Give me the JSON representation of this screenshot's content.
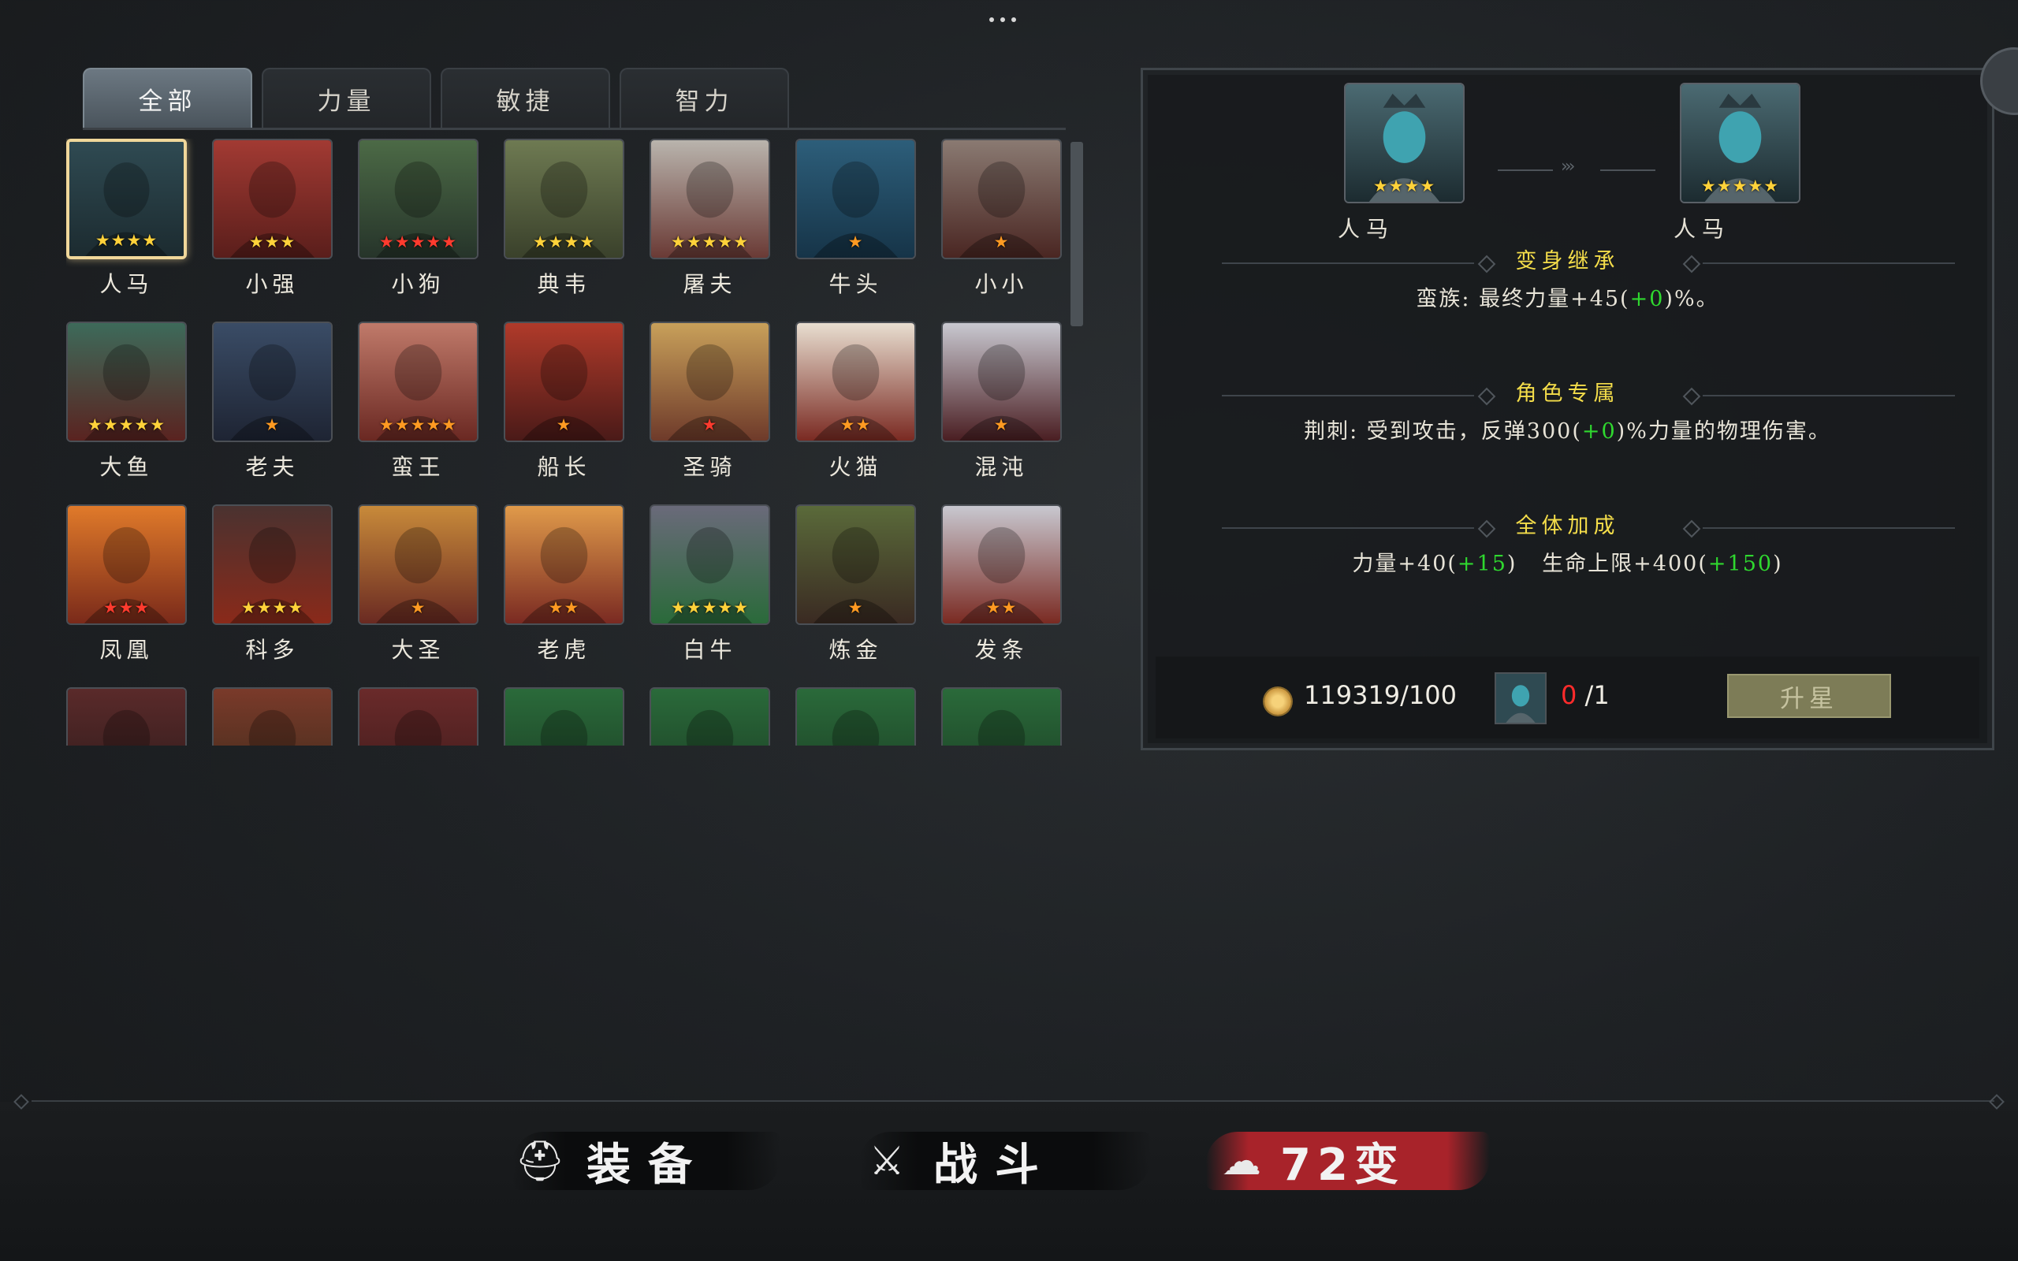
{
  "tabs": [
    "全部",
    "力量",
    "敏捷",
    "智力"
  ],
  "heroes": [
    {
      "name": "人马",
      "stars": "★★★★",
      "star_color": "gold",
      "colors": [
        "#2f4a52",
        "#1c2b30"
      ],
      "selected": true
    },
    {
      "name": "小强",
      "stars": "★★★",
      "star_color": "gold",
      "colors": [
        "#a23a33",
        "#5a1e1b"
      ]
    },
    {
      "name": "小狗",
      "stars": "★★★★★",
      "star_color": "red",
      "colors": [
        "#4c6a46",
        "#26342a"
      ]
    },
    {
      "name": "典韦",
      "stars": "★★★★",
      "star_color": "gold",
      "colors": [
        "#6e7a52",
        "#3a412b"
      ]
    },
    {
      "name": "屠夫",
      "stars": "★★★★★",
      "star_color": "gold",
      "colors": [
        "#b9b4ad",
        "#6a3a35"
      ]
    },
    {
      "name": "牛头",
      "stars": "★",
      "star_color": "orange",
      "colors": [
        "#2d5e7a",
        "#163448"
      ]
    },
    {
      "name": "小小",
      "stars": "★",
      "star_color": "orange",
      "colors": [
        "#8a7a72",
        "#4a2622"
      ]
    },
    {
      "name": "大鱼",
      "stars": "★★★★★",
      "star_color": "gold",
      "colors": [
        "#3d6a5a",
        "#5a2320"
      ]
    },
    {
      "name": "老夫",
      "stars": "★",
      "star_color": "orange",
      "colors": [
        "#3a4c66",
        "#1e2433"
      ]
    },
    {
      "name": "蛮王",
      "stars": "★★★★★",
      "star_color": "orange",
      "colors": [
        "#c07a6a",
        "#6a2822"
      ]
    },
    {
      "name": "船长",
      "stars": "★",
      "star_color": "orange",
      "colors": [
        "#b03a2a",
        "#4a1a18"
      ]
    },
    {
      "name": "圣骑",
      "stars": "★",
      "star_color": "red",
      "colors": [
        "#c8a05a",
        "#6e3a2a"
      ]
    },
    {
      "name": "火猫",
      "stars": "★★",
      "star_color": "orange",
      "colors": [
        "#e8ded0",
        "#7a2a22"
      ]
    },
    {
      "name": "混沌",
      "stars": "★",
      "star_color": "orange",
      "colors": [
        "#c8c8d0",
        "#4a1e22"
      ]
    },
    {
      "name": "凤凰",
      "stars": "★★★",
      "star_color": "red",
      "colors": [
        "#e07a2a",
        "#7a2a1a"
      ]
    },
    {
      "name": "科多",
      "stars": "★★★★",
      "star_color": "gold",
      "colors": [
        "#4a3230",
        "#8a2a1a"
      ]
    },
    {
      "name": "大圣",
      "stars": "★",
      "star_color": "orange",
      "colors": [
        "#c88a3a",
        "#6a2a22"
      ]
    },
    {
      "name": "老虎",
      "stars": "★★",
      "star_color": "orange",
      "colors": [
        "#e09a4a",
        "#7a2a22"
      ]
    },
    {
      "name": "白牛",
      "stars": "★★★★★",
      "star_color": "gold",
      "colors": [
        "#6a6a7a",
        "#2a6a3a"
      ]
    },
    {
      "name": "炼金",
      "stars": "★",
      "star_color": "orange",
      "colors": [
        "#5a6a3a",
        "#3a2a22"
      ]
    },
    {
      "name": "发条",
      "stars": "★★",
      "star_color": "orange",
      "colors": [
        "#c8c8d0",
        "#7a2a22"
      ]
    },
    {
      "name": "",
      "stars": "",
      "star_color": "gold",
      "colors": [
        "#5a2a2a",
        "#2a1a1a"
      ]
    },
    {
      "name": "",
      "stars": "",
      "star_color": "gold",
      "colors": [
        "#7a3a2a",
        "#3a2a1a"
      ]
    },
    {
      "name": "",
      "stars": "",
      "star_color": "gold",
      "colors": [
        "#6a2a2a",
        "#3a1a1a"
      ]
    },
    {
      "name": "",
      "stars": "",
      "star_color": "gold",
      "colors": [
        "#2a6a3a",
        "#1a3a22"
      ]
    },
    {
      "name": "",
      "stars": "",
      "star_color": "gold",
      "colors": [
        "#2a6a3a",
        "#1a3a22"
      ]
    },
    {
      "name": "",
      "stars": "",
      "star_color": "gold",
      "colors": [
        "#2a6a3a",
        "#1a3a22"
      ]
    },
    {
      "name": "",
      "stars": "",
      "star_color": "gold",
      "colors": [
        "#2a6a3a",
        "#1a3a22"
      ]
    }
  ],
  "panel": {
    "from": {
      "name": "人马",
      "stars": "★★★★"
    },
    "to": {
      "name": "人马",
      "stars": "★★★★★"
    },
    "sections": [
      {
        "title": "变身继承",
        "text_pre": "蛮族: 最终力量+45(",
        "text_green": "+0",
        "text_post": ")%。"
      },
      {
        "title": "角色专属",
        "text_pre": "荆刺: 受到攻击，反弹300(",
        "text_green": "+0",
        "text_post": ")%力量的物理伤害。"
      },
      {
        "title": "全体加成",
        "text_a_pre": "力量+40(",
        "text_a_green": "+15",
        "text_a_post": ")",
        "text_b_pre": "生命上限+400(",
        "text_b_green": "+150",
        "text_b_post": ")"
      }
    ],
    "coins": "119319/100",
    "fragments_have": "0",
    "fragments_need": "/1",
    "upgrade_label": "升星"
  },
  "nav": {
    "equipment": "装备",
    "battle": "战斗",
    "transform": "72变"
  },
  "colors": {
    "accent_yellow": "#f4dd4a",
    "green": "#2fd82f",
    "red": "#ff2b2b",
    "brush_red": "#a8232a"
  }
}
